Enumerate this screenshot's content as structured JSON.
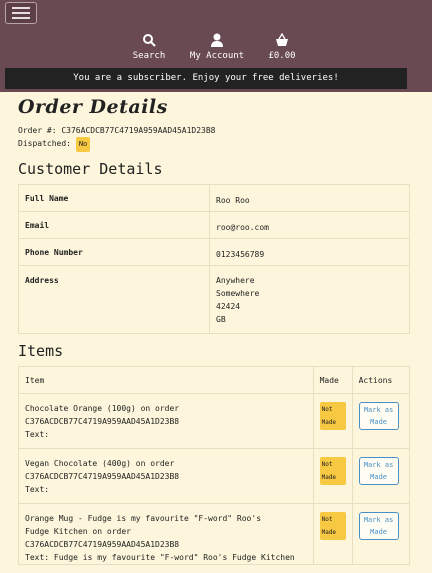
{
  "header": {
    "nav": [
      {
        "label": "Search",
        "icon": "search-icon"
      },
      {
        "label": "My Account",
        "icon": "user-icon"
      },
      {
        "label": "£0.00",
        "icon": "basket-icon"
      }
    ],
    "banner": "You are a subscriber. Enjoy your free deliveries!"
  },
  "order": {
    "title": "Order Details",
    "number_label": "Order #:",
    "number": "C376ACDCB77C4719A959AAD45A1D23B8",
    "dispatched_label": "Dispatched:",
    "dispatched_value": "No"
  },
  "customer": {
    "heading": "Customer Details",
    "rows": [
      {
        "label": "Full Name",
        "value": "Roo Roo"
      },
      {
        "label": "Email",
        "value": "roo@roo.com"
      },
      {
        "label": "Phone Number",
        "value": "0123456789"
      }
    ],
    "address_label": "Address",
    "address_lines": [
      "Anywhere",
      "Somewhere",
      "42424",
      "GB"
    ]
  },
  "items": {
    "heading": "Items",
    "columns": [
      "Item",
      "Made",
      "Actions"
    ],
    "rows": [
      {
        "desc1": "Chocolate Orange (100g) on order",
        "desc2": "C376ACDCB77C4719A959AAD45A1D23B8",
        "text": "Text:",
        "made": "Not Made",
        "action": "Mark as Made"
      },
      {
        "desc1": "Vegan Chocolate (400g) on order",
        "desc2": "C376ACDCB77C4719A959AAD45A1D23B8",
        "text": "Text:",
        "made": "Not Made",
        "action": "Mark as Made"
      },
      {
        "desc1": "Orange Mug - Fudge is my favourite \"F-word\" Roo's",
        "desc2": "Fudge Kitchen on order",
        "desc3": "C376ACDCB77C4719A959AAD45A1D23B8",
        "text": "Text: Fudge is my favourite \"F-word\" Roo's Fudge Kitchen",
        "made": "Not Made",
        "action": "Mark as Made"
      }
    ]
  },
  "colors": {
    "header": "#6a4a52",
    "page": "#fdf6dc",
    "badge": "#f7c842",
    "button": "#4a8fc5"
  }
}
